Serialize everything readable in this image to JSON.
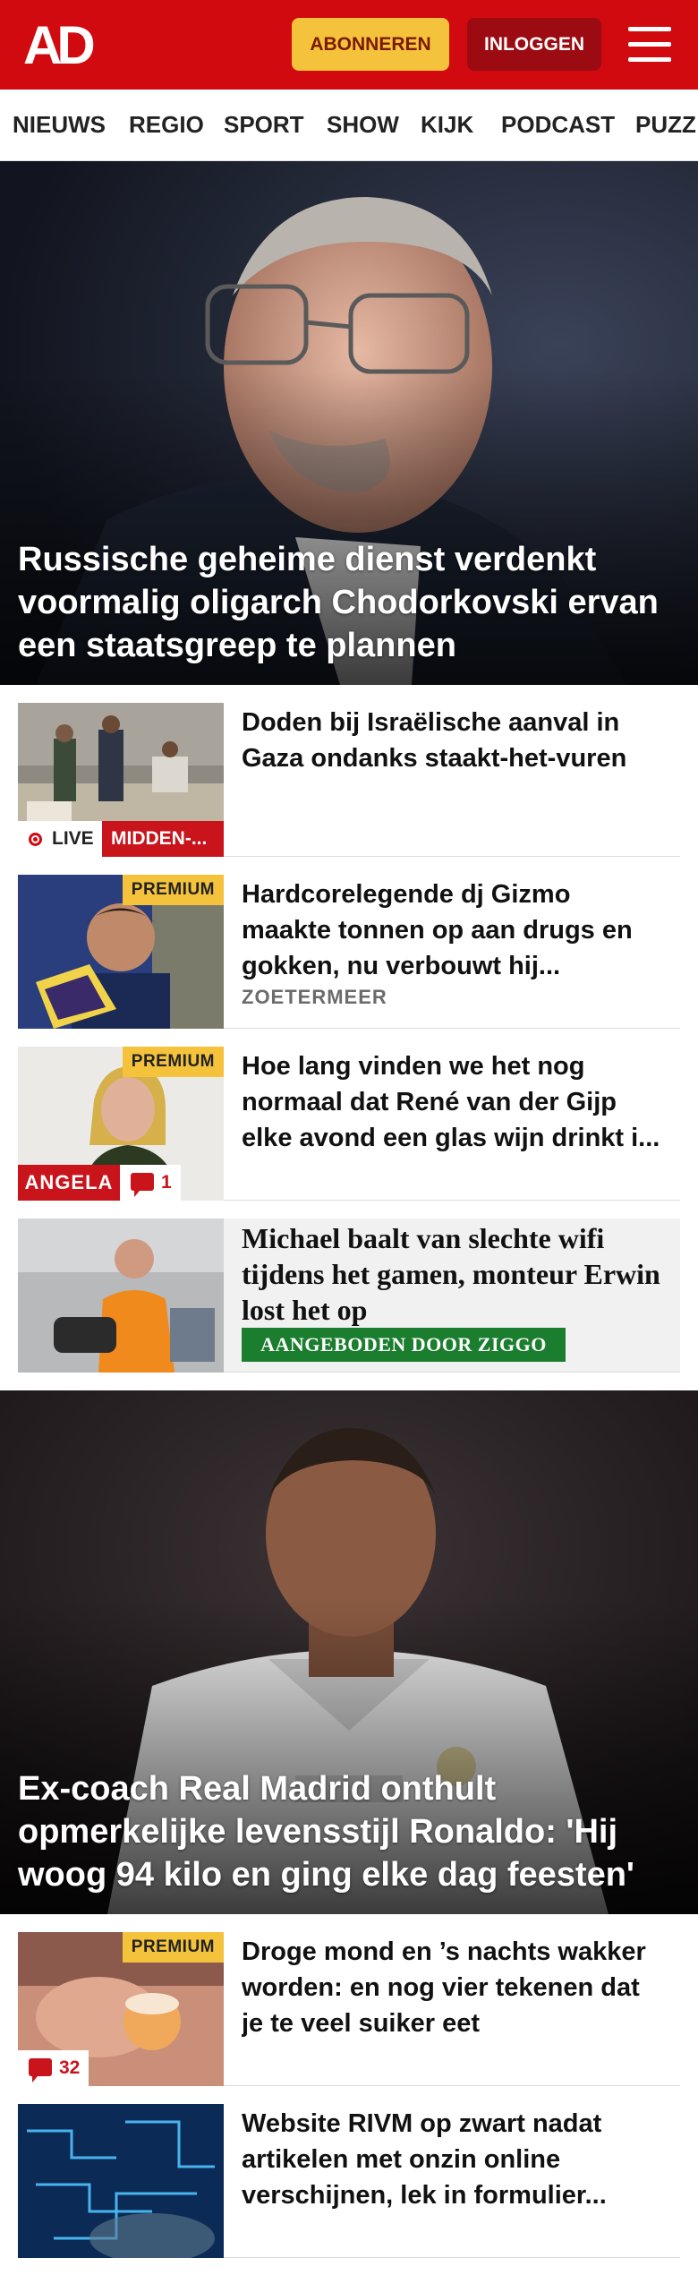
{
  "header": {
    "logo": "AD",
    "subscribe_label": "ABONNEREN",
    "login_label": "INLOGGEN",
    "menu_icon": "hamburger-menu-icon",
    "brand_color": "#d10a10"
  },
  "nav": {
    "items": [
      "NIEUWS",
      "REGIO",
      "SPORT",
      "SHOW",
      "KIJK",
      "PODCAST",
      "PUZZ"
    ]
  },
  "hero1": {
    "headline": "Russische geheime dienst verdenkt voormalig oligarch Chodorkovski ervan een staatsgreep te plannen"
  },
  "articles": [
    {
      "title": "Doden bij Israëlische aanval in Gaza ondanks staakt-het-vuren",
      "live_label": "LIVE",
      "category": "MIDDEN-..."
    },
    {
      "title": "Hardcorelegende dj Gizmo maakte tonnen op aan drugs en gokken, nu verbouwt hij...",
      "premium": "PREMIUM",
      "kicker": "ZOETERMEER"
    },
    {
      "title": "Hoe lang vinden we het nog normaal dat René van der Gijp elke avond een glas wijn drinkt i...",
      "premium": "PREMIUM",
      "author_label": "ANGELA",
      "comments": "1"
    },
    {
      "title": "Michael baalt van slechte wifi tijdens het gamen, monteur Erwin lost het op",
      "sponsor": "AANGEBODEN DOOR ZIGGO",
      "sponsor_color": "#1b7d2e"
    }
  ],
  "hero2": {
    "headline": "Ex-coach Real Madrid onthult opmerkelijke levensstijl Ronaldo: 'Hij woog 94 kilo en ging elke dag feesten'"
  },
  "articles2": [
    {
      "title": "Droge mond en ’s nachts wakker worden: en nog vier tekenen dat je te veel suiker eet",
      "premium": "PREMIUM",
      "comments": "32"
    },
    {
      "title": "Website RIVM op zwart nadat artikelen met onzin online verschijnen, lek in formulier..."
    }
  ]
}
